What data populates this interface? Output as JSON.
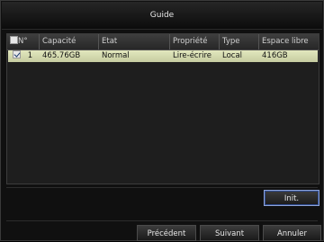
{
  "title": "Guide",
  "table": {
    "headers": {
      "num": "N°",
      "capacity": "Capacité",
      "state": "Etat",
      "property": "Propriété",
      "type": "Type",
      "free": "Espace libre"
    },
    "rows": [
      {
        "checked": true,
        "num": "1",
        "capacity": "465.76GB",
        "state": "Normal",
        "property": "Lire-écrire",
        "type": "Local",
        "free": "416GB"
      }
    ]
  },
  "buttons": {
    "init": "Init.",
    "previous": "Précédent",
    "next": "Suivant",
    "cancel": "Annuler"
  },
  "colors": {
    "row_selected": "#d6dbb0",
    "background": "#101010"
  }
}
